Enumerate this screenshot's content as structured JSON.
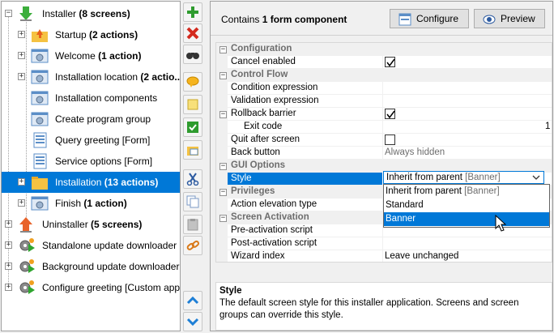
{
  "tree": {
    "items": [
      {
        "label": "Installer",
        "count": "(8 screens)"
      },
      {
        "label": "Startup",
        "count": "(2 actions)"
      },
      {
        "label": "Welcome",
        "count": "(1 action)"
      },
      {
        "label": "Installation location",
        "count": "(2 actio..."
      },
      {
        "label": "Installation components",
        "count": ""
      },
      {
        "label": "Create program group",
        "count": ""
      },
      {
        "label": "Query greeting [Form]",
        "count": ""
      },
      {
        "label": "Service options [Form]",
        "count": ""
      },
      {
        "label": "Installation",
        "count": "(13 actions)"
      },
      {
        "label": "Finish",
        "count": "(1 action)"
      },
      {
        "label": "Uninstaller",
        "count": "(5 screens)"
      },
      {
        "label": "Standalone update downloader [...",
        "count": ""
      },
      {
        "label": "Background update downloader ...",
        "count": ""
      },
      {
        "label": "Configure greeting [Custom appl...",
        "count": ""
      }
    ]
  },
  "toolbar": {
    "buttons": [
      "add-icon",
      "delete-icon",
      "find-icon",
      "comment-icon",
      "note-icon",
      "check-icon",
      "folder-screen-icon",
      "cut-icon",
      "copy-icon",
      "paste-icon",
      "link-icon",
      "move-up-icon",
      "move-down-icon"
    ]
  },
  "header": {
    "contains_prefix": "Contains",
    "contains_bold": "1 form component",
    "configure_label": "Configure",
    "preview_label": "Preview"
  },
  "properties": {
    "group_configuration": "Configuration",
    "cancel_enabled": "Cancel enabled",
    "group_control_flow": "Control Flow",
    "condition_expression": "Condition expression",
    "validation_expression": "Validation expression",
    "rollback_barrier": "Rollback barrier",
    "exit_code": "Exit code",
    "exit_code_value": "1",
    "quit_after_screen": "Quit after screen",
    "back_button": "Back button",
    "back_button_value": "Always hidden",
    "group_gui_options": "GUI Options",
    "style": "Style",
    "group_privileges": "Privileges",
    "action_elevation_type": "Action elevation type",
    "group_screen_activation": "Screen Activation",
    "pre_activation_script": "Pre-activation script",
    "post_activation_script": "Post-activation script",
    "wizard_index": "Wizard index",
    "wizard_index_value": "Leave unchanged"
  },
  "style_dropdown": {
    "current_main": "Inherit from parent",
    "current_hint": "[Banner]",
    "options": [
      {
        "main": "Inherit from parent",
        "hint": "[Banner]"
      },
      {
        "main": "Standard",
        "hint": ""
      },
      {
        "main": "Banner",
        "hint": ""
      }
    ],
    "highlighted": "Banner"
  },
  "description": {
    "title": "Style",
    "text": "The default screen style for this installer application. Screens and screen groups can override this style."
  },
  "colors": {
    "selection": "#0078d7",
    "group_text": "#6d6d6d"
  }
}
